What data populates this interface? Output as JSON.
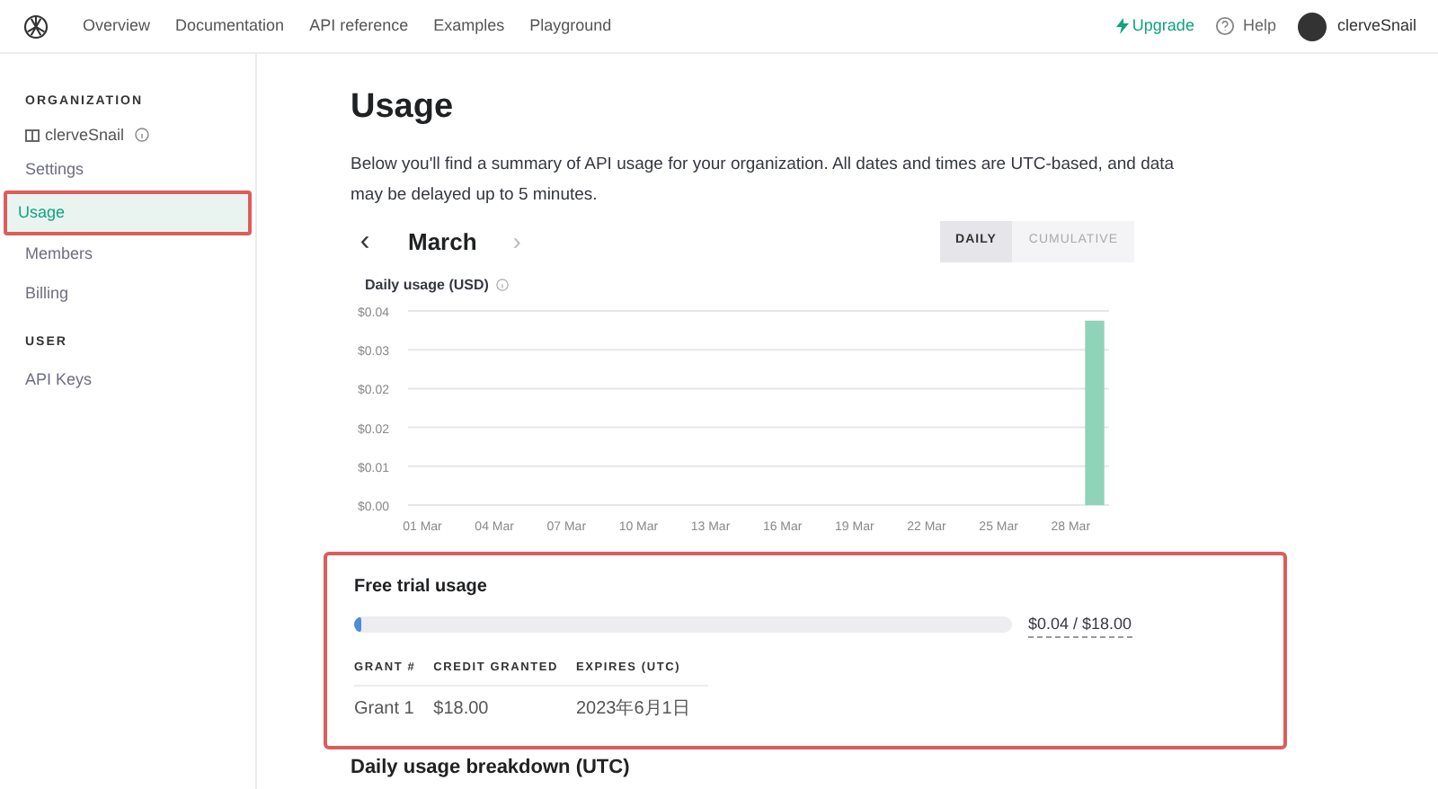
{
  "nav": {
    "links": [
      "Overview",
      "Documentation",
      "API reference",
      "Examples",
      "Playground"
    ],
    "upgrade": "Upgrade",
    "help": "Help",
    "user": "clerveSnail"
  },
  "sidebar": {
    "sections": [
      {
        "heading": "ORGANIZATION",
        "org": "clerveSnail",
        "items": [
          {
            "label": "Settings",
            "selected": false,
            "highlighted": false
          },
          {
            "label": "Usage",
            "selected": true,
            "highlighted": true
          },
          {
            "label": "Members",
            "selected": false,
            "highlighted": false
          },
          {
            "label": "Billing",
            "selected": false,
            "highlighted": false
          }
        ]
      },
      {
        "heading": "USER",
        "items": [
          {
            "label": "API Keys",
            "selected": false,
            "highlighted": false
          }
        ]
      }
    ]
  },
  "page": {
    "title": "Usage",
    "intro": "Below you'll find a summary of API usage for your organization. All dates and times are UTC-based, and data may be delayed up to 5 minutes.",
    "month": "March",
    "prev": "‹",
    "next": "›",
    "toggle": [
      {
        "label": "DAILY",
        "selected": true
      },
      {
        "label": "CUMULATIVE",
        "selected": false
      }
    ],
    "chart_title": "Daily usage (USD)",
    "chart_data": {
      "type": "bar",
      "categories": [
        "01 Mar",
        null,
        null,
        "04 Mar",
        null,
        null,
        "07 Mar",
        null,
        null,
        "10 Mar",
        null,
        null,
        "13 Mar",
        null,
        null,
        "16 Mar",
        null,
        null,
        "19 Mar",
        null,
        null,
        "22 Mar",
        null,
        null,
        "25 Mar",
        null,
        null,
        "28 Mar",
        null
      ],
      "series": [
        {
          "color": "#8fd3b8",
          "values": [
            0,
            0,
            0,
            0,
            0,
            0,
            0,
            0,
            0,
            0,
            0,
            0,
            0,
            0,
            0,
            0,
            0,
            0,
            0,
            0,
            0,
            0,
            0,
            0,
            0,
            0,
            0,
            0,
            0.038
          ]
        }
      ],
      "ylim": [
        0,
        0.04
      ],
      "grid": true,
      "yticks": [
        {
          "value": 0,
          "label": "$0.00"
        },
        {
          "value": 0.008,
          "label": "$0.01"
        },
        {
          "value": 0.016,
          "label": "$0.02"
        },
        {
          "value": 0.024,
          "label": "$0.02"
        },
        {
          "value": 0.032,
          "label": "$0.03"
        },
        {
          "value": 0.04,
          "label": "$0.04"
        }
      ]
    },
    "free_trial": {
      "title": "Free trial usage",
      "highlighted": true,
      "level": 0.0022,
      "reading": "$0.04 / $18.00",
      "columns": [
        "GRANT #",
        "CREDIT GRANTED",
        "EXPIRES (UTC)"
      ],
      "rows": [
        [
          "Grant 1",
          "$18.00",
          "2023年6月1日"
        ]
      ]
    },
    "next_heading": "Daily usage breakdown (UTC)"
  }
}
